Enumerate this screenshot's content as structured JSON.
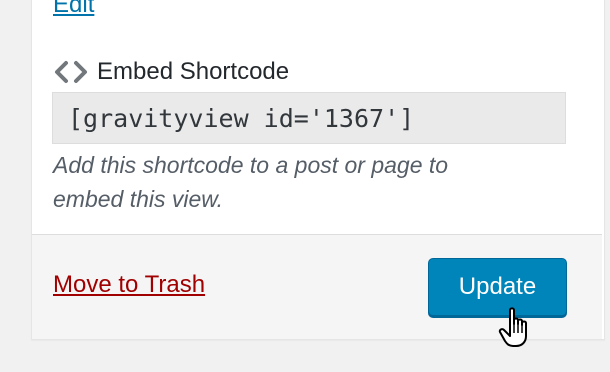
{
  "publish_box": {
    "edit_label": "Edit",
    "embed": {
      "heading": "Embed Shortcode",
      "icon": "code-brackets-icon",
      "shortcode": "[gravityview id='1367']",
      "help_line1": "Add this shortcode to a post or page to",
      "help_line2": "embed this view."
    },
    "actions": {
      "trash_label": "Move to Trash",
      "update_label": "Update"
    }
  },
  "colors": {
    "link": "#0073aa",
    "trash": "#a00000",
    "button": "#0085ba"
  }
}
